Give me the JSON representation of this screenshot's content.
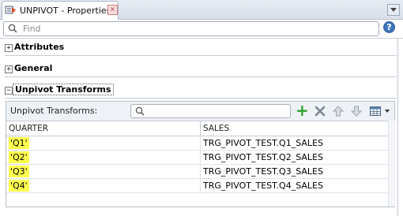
{
  "window": {
    "tab_title": "UNPIVOT - Properties",
    "icon": "unpivot-operator-icon"
  },
  "search": {
    "placeholder": "Find",
    "help": "?"
  },
  "sections": [
    {
      "label": "Attributes",
      "state": "collapsed",
      "toggle": "+"
    },
    {
      "label": "General",
      "state": "collapsed",
      "toggle": "+"
    },
    {
      "label": "Unpivot Transforms",
      "state": "expanded",
      "toggle": "−"
    }
  ],
  "unpivot": {
    "toolbar_label": "Unpivot Transforms:",
    "buttons": [
      "add-icon",
      "delete-icon",
      "move-up-icon",
      "move-down-icon",
      "table-view-icon"
    ],
    "columns": [
      "QUARTER",
      "SALES"
    ],
    "rows": [
      {
        "quarter": "'Q1'",
        "sales": "TRG_PIVOT_TEST.Q1_SALES"
      },
      {
        "quarter": "'Q2'",
        "sales": "TRG_PIVOT_TEST.Q2_SALES"
      },
      {
        "quarter": "'Q3'",
        "sales": "TRG_PIVOT_TEST.Q3_SALES"
      },
      {
        "quarter": "'Q4'",
        "sales": "TRG_PIVOT_TEST.Q4_SALES"
      }
    ]
  },
  "colors": {
    "highlight": "#ffff4d",
    "accent": "#1d4f9a",
    "add_green": "#2ea12a"
  }
}
